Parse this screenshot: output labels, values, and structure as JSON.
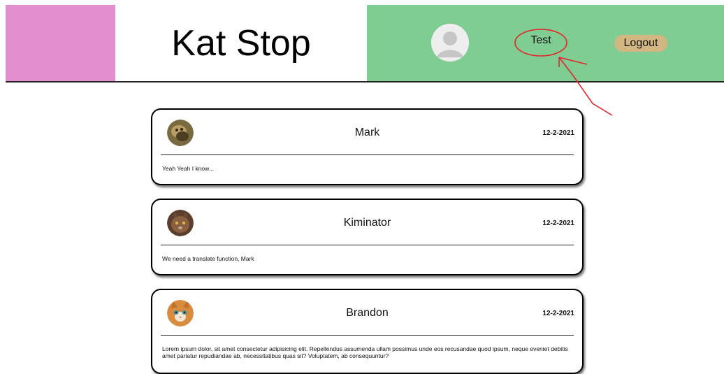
{
  "header": {
    "brand_title": "Kat Stop",
    "username": "Test",
    "logout_label": "Logout",
    "colors": {
      "brand_block": "#e38ecf",
      "nav_bar": "#80cd93",
      "logout_button": "#d2b782",
      "annotation": "#e3242b"
    },
    "avatar_icon": "default-user-icon"
  },
  "posts": [
    {
      "author": "Mark",
      "date": "12-2-2021",
      "text": "Yeah Yeah I know...",
      "avatar_icon": "cat-photo-icon"
    },
    {
      "author": "Kiminator",
      "date": "12-2-2021",
      "text": "We need a translate function, Mark",
      "avatar_icon": "cat-photo-icon"
    },
    {
      "author": "Brandon",
      "date": "12-2-2021",
      "text": "Lorem ipsum dolor, sit amet consectetur adipisicing elit. Repellendus assumenda ullam possimus unde eos recusandae quod ipsum, neque eveniet debitis amet pariatur repudiandae ab, necessitatibus quas sit? Voluptatem, ab consequuntur?",
      "avatar_icon": "cat-photo-icon"
    }
  ]
}
